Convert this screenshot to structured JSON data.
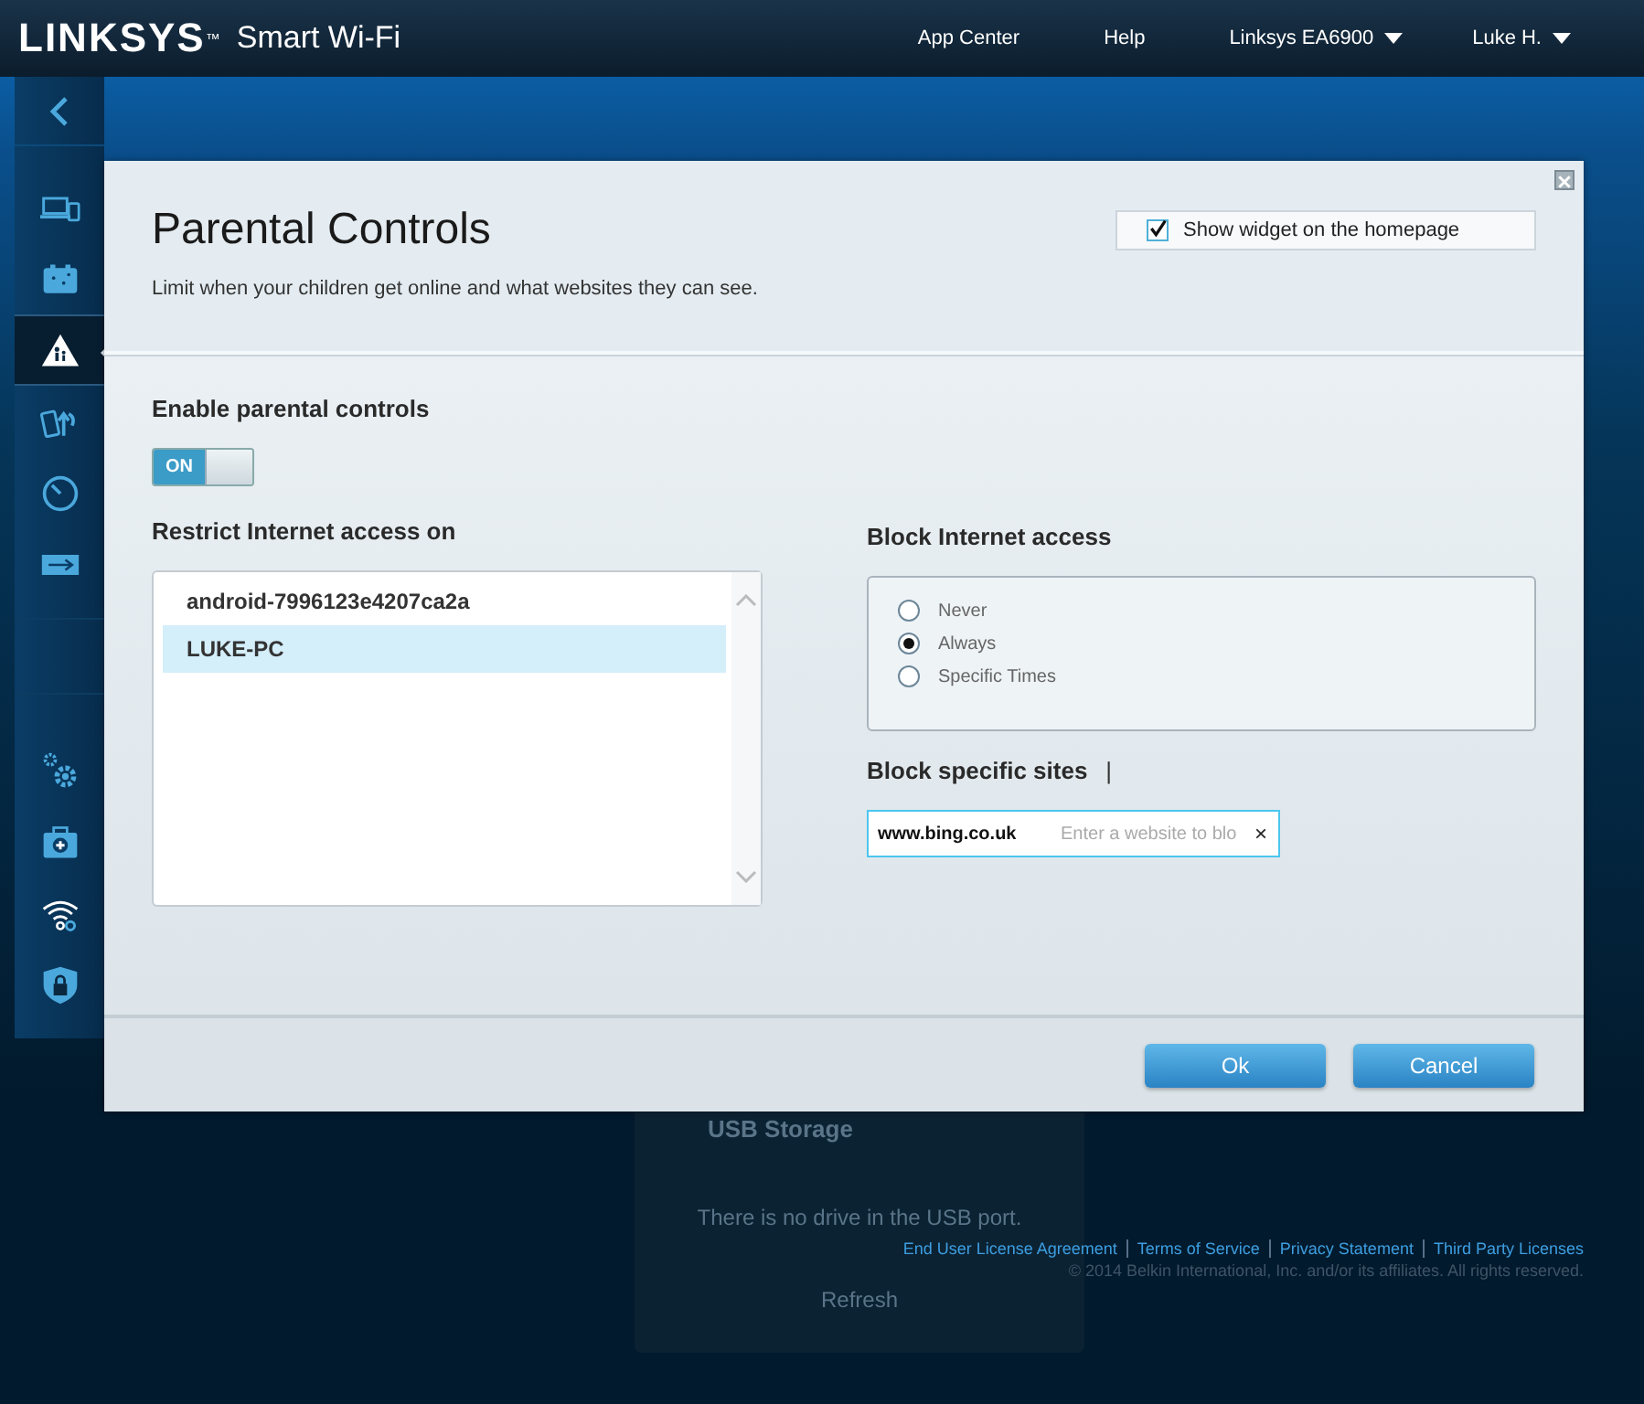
{
  "top_bar": {
    "logo": "LINKSYS",
    "logo_mark": "™",
    "product": "Smart Wi-Fi",
    "nav": [
      {
        "label": "App Center",
        "dropdown": false
      },
      {
        "label": "Help",
        "dropdown": false
      },
      {
        "label": "Linksys EA6900",
        "dropdown": true
      },
      {
        "label": "Luke H.",
        "dropdown": true
      }
    ]
  },
  "sidebar": {
    "groups": [
      {
        "items": [
          {
            "selected": false
          },
          {
            "selected": false
          },
          {
            "selected": true
          },
          {
            "selected": false
          },
          {
            "selected": false
          },
          {
            "selected": false
          }
        ]
      },
      {
        "items": [
          {
            "selected": false
          },
          {
            "selected": false
          },
          {
            "selected": false
          },
          {
            "selected": false
          }
        ]
      }
    ]
  },
  "background_card": {
    "title": "USB Storage",
    "message": "There is no drive in the USB port.",
    "button": "Refresh"
  },
  "dialog": {
    "title": "Parental Controls",
    "subtitle": "Limit when your children get online and what websites they can see.",
    "widget_option": {
      "label": "Show widget on the homepage",
      "checked": true
    },
    "enable": {
      "label": "Enable parental controls",
      "switch_label": "ON",
      "on": true
    },
    "restrict": {
      "label": "Restrict Internet access on",
      "devices": [
        {
          "name": "android-7996123e4207ca2a",
          "selected": false
        },
        {
          "name": "LUKE-PC",
          "selected": true
        }
      ]
    },
    "block_access": {
      "label": "Block Internet access",
      "options": [
        {
          "label": "Never",
          "selected": false
        },
        {
          "label": "Always",
          "selected": true
        },
        {
          "label": "Specific Times",
          "selected": false
        }
      ]
    },
    "block_sites": {
      "label": "Block specific sites",
      "marker": "|",
      "field": {
        "value": "www.bing.co.uk",
        "placeholder": "Enter a website to blo",
        "clear": "×"
      }
    },
    "buttons": [
      {
        "label": "Ok"
      },
      {
        "label": "Cancel"
      }
    ]
  },
  "footer": {
    "links": [
      {
        "label": "End User License Agreement"
      },
      {
        "label": "Terms of Service"
      },
      {
        "label": "Privacy Statement"
      },
      {
        "label": "Third Party Licenses"
      }
    ],
    "copyright": "© 2014 Belkin International, Inc. and/or its affiliates. All rights reserved."
  }
}
